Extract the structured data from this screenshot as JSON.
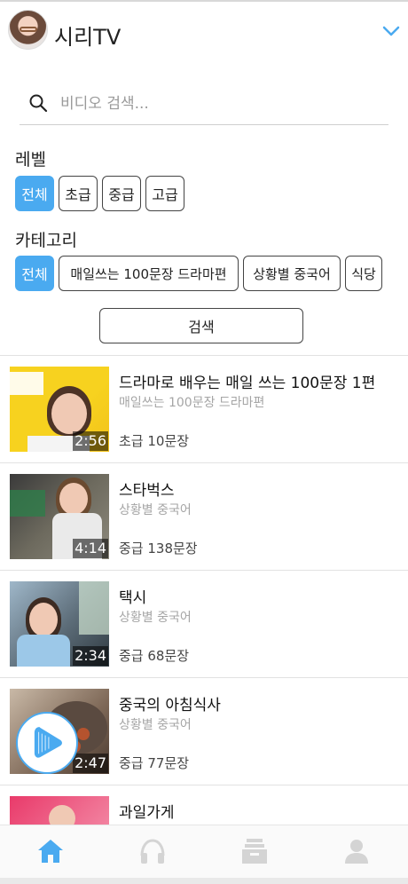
{
  "app": {
    "title": "시리TV"
  },
  "search": {
    "placeholder": "비디오 검색..."
  },
  "level": {
    "label": "레벨",
    "options": [
      "전체",
      "초급",
      "중급",
      "고급"
    ],
    "selected": "전체"
  },
  "category": {
    "label": "카테고리",
    "options": [
      "전체",
      "매일쓰는 100문장 드라마편",
      "상황별 중국어",
      "식당"
    ],
    "selected": "전체"
  },
  "search_button": {
    "label": "검색"
  },
  "videos": [
    {
      "title": "드라마로 배우는 매일 쓰는 100문장 1편",
      "category": "매일쓰는 100문장 드라마편",
      "meta": "초급 10문장",
      "duration": "2:56"
    },
    {
      "title": "스타벅스",
      "category": "상황별 중국어",
      "meta": "중급 138문장",
      "duration": "4:14"
    },
    {
      "title": "택시",
      "category": "상황별 중국어",
      "meta": "중급 68문장",
      "duration": "2:34"
    },
    {
      "title": "중국의 아침식사",
      "category": "상황별 중국어",
      "meta": "중급 77문장",
      "duration": "2:47"
    },
    {
      "title": "과일가게"
    }
  ],
  "nav": [
    "home-icon",
    "headphones-icon",
    "archive-icon",
    "person-icon"
  ],
  "colors": {
    "accent": "#4aaaf0",
    "nav_inactive": "#d4d4d4"
  }
}
